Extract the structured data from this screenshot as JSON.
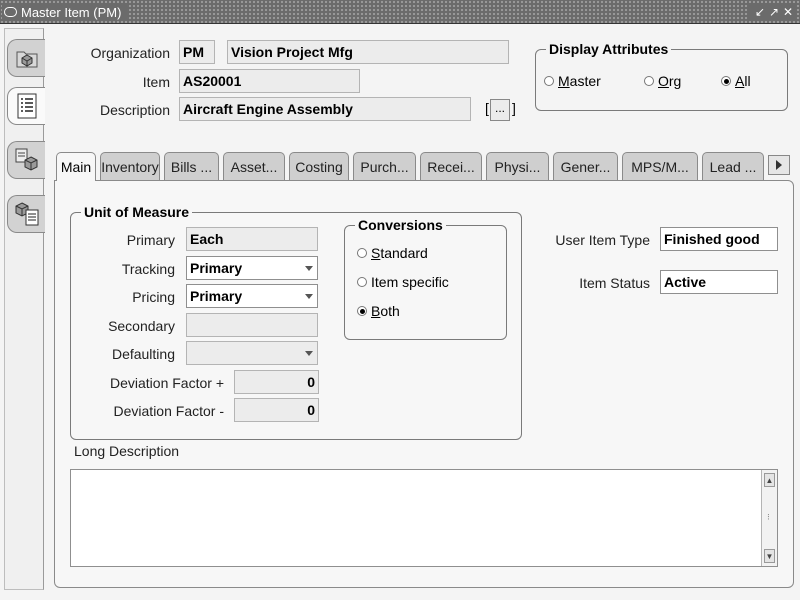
{
  "window": {
    "title": "Master Item (PM)",
    "controls": [
      "↙",
      "↗",
      "✕"
    ]
  },
  "nav": {
    "icons": [
      "folder-cube-icon",
      "list-icon",
      "item-cubes-icon",
      "cube-list-icon"
    ]
  },
  "header": {
    "organization_label": "Organization",
    "organization_code": "PM",
    "organization_name": "Vision Project Mfg",
    "item_label": "Item",
    "item_value": "AS20001",
    "description_label": "Description",
    "description_value": "Aircraft Engine Assembly",
    "editor_button_label": "...",
    "bracket_open": "[",
    "bracket_close": "]"
  },
  "display_attributes": {
    "title": "Display Attributes",
    "options": [
      {
        "label": "Master",
        "selected": false
      },
      {
        "label": "Org",
        "selected": false
      },
      {
        "label": "All",
        "selected": true
      }
    ]
  },
  "tabs": [
    {
      "label": "Main",
      "active": true
    },
    {
      "label": "Inventory",
      "active": false
    },
    {
      "label": "Bills ...",
      "active": false
    },
    {
      "label": "Asset...",
      "active": false
    },
    {
      "label": "Costing",
      "active": false
    },
    {
      "label": "Purch...",
      "active": false
    },
    {
      "label": "Recei...",
      "active": false
    },
    {
      "label": "Physi...",
      "active": false
    },
    {
      "label": "Gener...",
      "active": false
    },
    {
      "label": "MPS/M...",
      "active": false
    },
    {
      "label": "Lead ...",
      "active": false
    }
  ],
  "uom": {
    "title": "Unit of Measure",
    "primary_label": "Primary",
    "primary_value": "Each",
    "tracking_label": "Tracking",
    "tracking_value": "Primary",
    "pricing_label": "Pricing",
    "pricing_value": "Primary",
    "secondary_label": "Secondary",
    "secondary_value": "",
    "defaulting_label": "Defaulting",
    "defaulting_value": "",
    "deviation_plus_label": "Deviation Factor +",
    "deviation_plus_value": "0",
    "deviation_minus_label": "Deviation Factor -",
    "deviation_minus_value": "0"
  },
  "conversions": {
    "title": "Conversions",
    "options": [
      {
        "label": "Standard",
        "selected": false
      },
      {
        "label": "Item specific",
        "selected": false
      },
      {
        "label": "Both",
        "selected": true
      }
    ]
  },
  "right_fields": {
    "user_item_type_label": "User Item Type",
    "user_item_type_value": "Finished good",
    "item_status_label": "Item Status",
    "item_status_value": "Active"
  },
  "long_description": {
    "label": "Long Description",
    "value": ""
  }
}
